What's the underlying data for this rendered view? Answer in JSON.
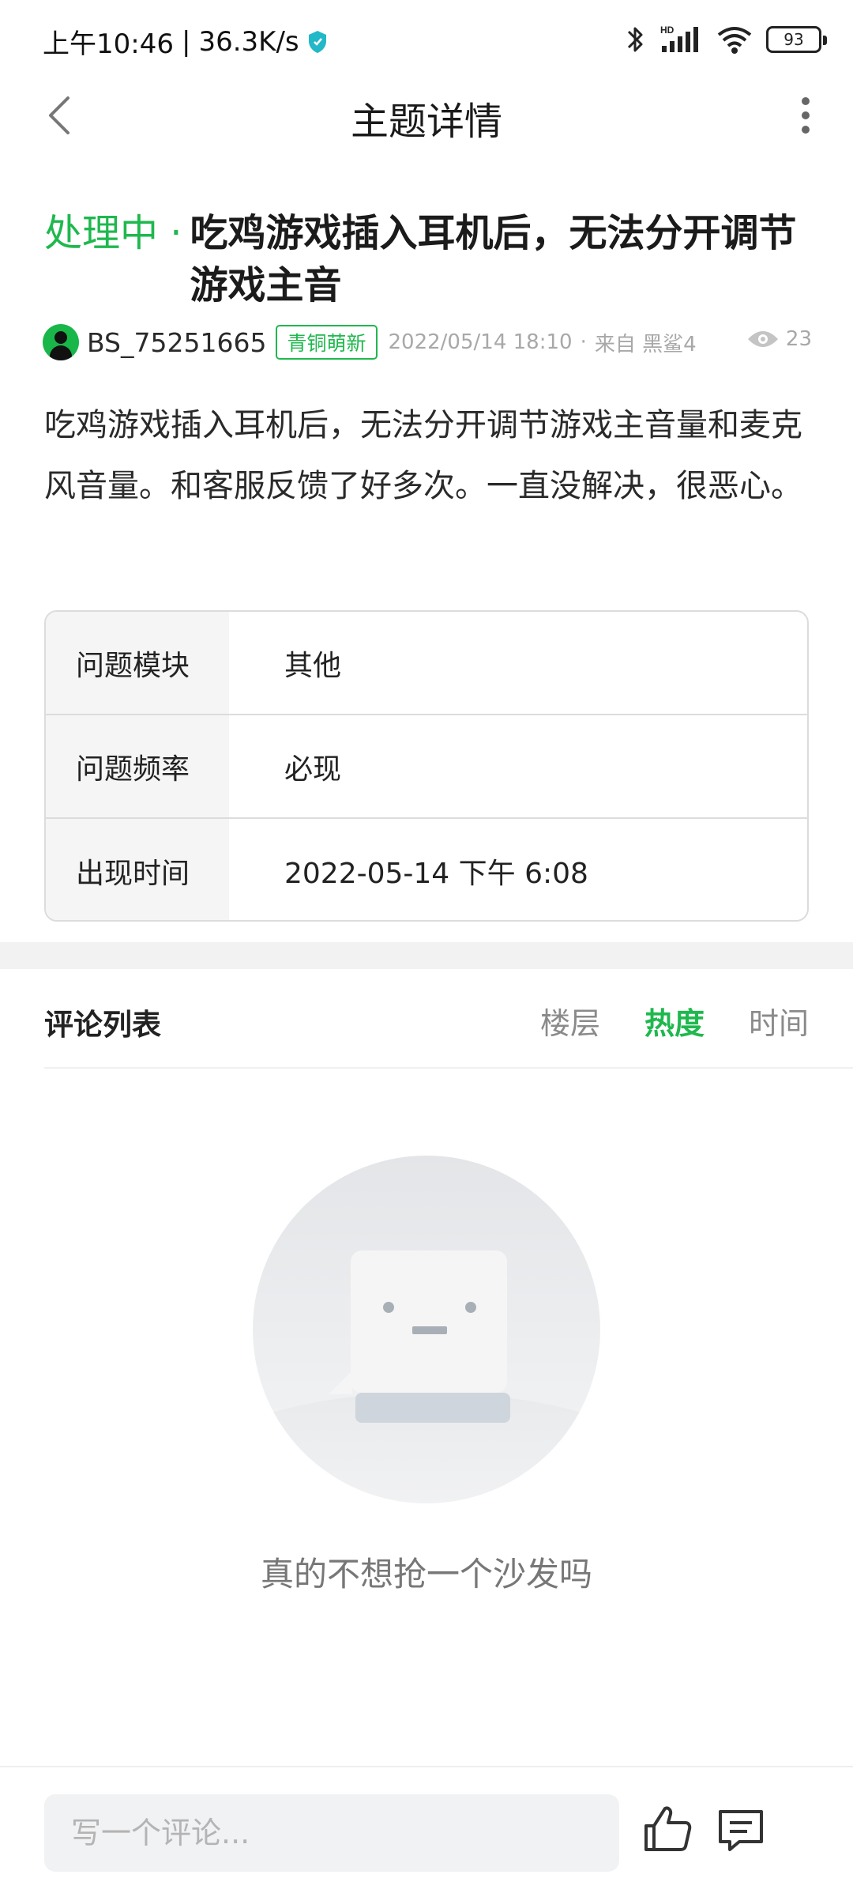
{
  "status_bar": {
    "time": "上午10:46",
    "net_speed": "36.3K/s",
    "separator": "|",
    "hd_label": "HD",
    "battery": "93",
    "icons": [
      "shield-icon",
      "bluetooth-icon",
      "signal-icon",
      "wifi-icon",
      "battery-icon"
    ]
  },
  "nav": {
    "title": "主题详情",
    "back_icon": "chevron-left-icon",
    "more_icon": "more-vertical-icon"
  },
  "post": {
    "status": "处理中 ·",
    "title": "吃鸡游戏插入耳机后，无法分开调节游戏主音",
    "author": "BS_75251665",
    "badge": "青铜萌新",
    "time": "2022/05/14 18:10",
    "dot": "·",
    "source": "来自 黑鲨4",
    "views": "23",
    "body": "吃鸡游戏插入耳机后，无法分开调节游戏主音量和麦克风音量。和客服反馈了好多次。一直没解决，很恶心。"
  },
  "info_table": {
    "rows": [
      {
        "key": "问题模块",
        "value": "其他"
      },
      {
        "key": "问题频率",
        "value": "必现"
      },
      {
        "key": "出现时间",
        "value": "2022-05-14 下午 6:08"
      }
    ]
  },
  "comments": {
    "title": "评论列表",
    "sort_tabs": [
      {
        "label": "楼层",
        "active": false
      },
      {
        "label": "热度",
        "active": true
      },
      {
        "label": "时间",
        "active": false
      }
    ],
    "empty_text": "真的不想抢一个沙发吗"
  },
  "bottom_bar": {
    "input_placeholder": "写一个评论...",
    "like_icon": "thumbs-up-icon",
    "comment_icon": "comment-icon"
  },
  "colors": {
    "accent": "#1fb84e",
    "text": "#222222",
    "muted": "#a8a8a8"
  }
}
